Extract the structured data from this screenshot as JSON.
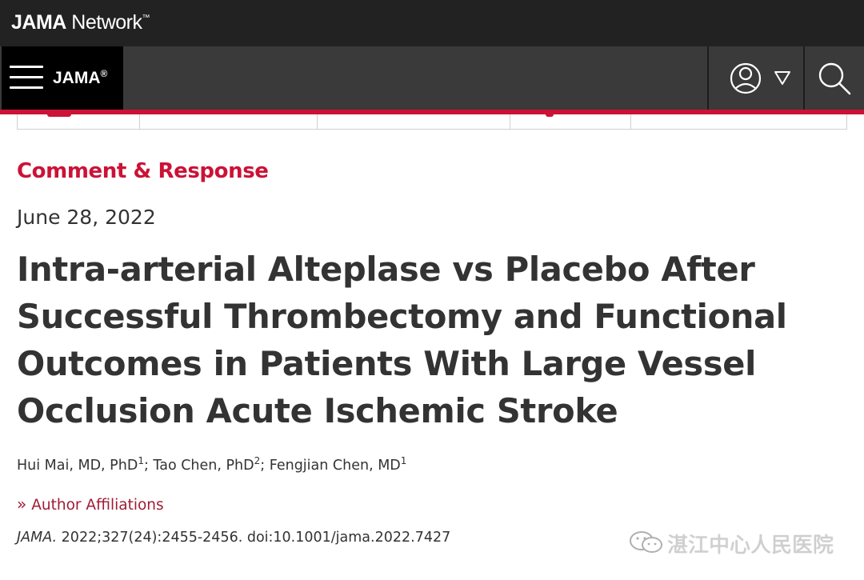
{
  "header": {
    "network_brand": "JAMA",
    "network_suffix": "Network",
    "network_tm": "™",
    "journal_brand": "JAMA",
    "journal_reg": "®",
    "icons": [
      "menu-icon",
      "user-icon",
      "dropdown-triangle-icon",
      "search-icon"
    ],
    "accent_color": "#cc1236"
  },
  "article": {
    "type": "Comment & Response",
    "date": "June 28, 2022",
    "title": "Intra-arterial Alteplase vs Placebo After Successful Thrombectomy and Functional Outcomes in Patients With Large Vessel Occlusion Acute Ischemic Stroke",
    "authors": [
      {
        "name": "Hui Mai, MD, PhD",
        "affil": "1",
        "sep": "; "
      },
      {
        "name": "Tao Chen, PhD",
        "affil": "2",
        "sep": "; "
      },
      {
        "name": "Fengjian Chen, MD",
        "affil": "1",
        "sep": ""
      }
    ],
    "affiliations_label": "Author Affiliations",
    "affiliations_icon": "chevron-right-double-icon",
    "citation_journal": "JAMA.",
    "citation_text": "2022;327(24):2455-2456. doi:10.1001/jama.2022.7427"
  },
  "watermark": {
    "text": "湛江中心人民医院",
    "icon": "wechat-icon"
  }
}
